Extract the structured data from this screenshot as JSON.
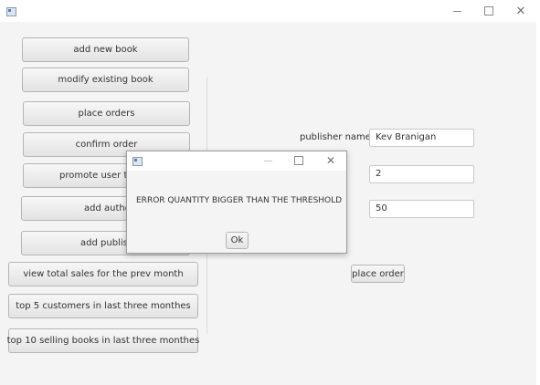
{
  "window": {
    "icons": {
      "app": "app-icon",
      "minimize": "minimize-icon",
      "maximize": "maximize-icon",
      "close": "close-icon"
    },
    "close_glyph": "✕"
  },
  "sidebar": {
    "buttons": [
      {
        "label": "add new book"
      },
      {
        "label": "modify existing book"
      },
      {
        "label": "place orders"
      },
      {
        "label": "confirm order"
      },
      {
        "label": "promote user to m"
      },
      {
        "label": "add author"
      },
      {
        "label": "add publisher"
      },
      {
        "label": "view total sales for the prev month"
      },
      {
        "label": "top 5 customers in last three monthes"
      },
      {
        "label": "top 10 selling books in last three monthes"
      }
    ]
  },
  "form": {
    "publisher_label": "publisher name",
    "publisher_value": "Kev Branigan",
    "field2_value": "2",
    "field3_value": "50",
    "place_order_label": "place order"
  },
  "dialog": {
    "message": "ERROR QUANTITY BIGGER THAN THE THRESHOLD",
    "ok_label": "Ok",
    "close_glyph": "✕"
  }
}
